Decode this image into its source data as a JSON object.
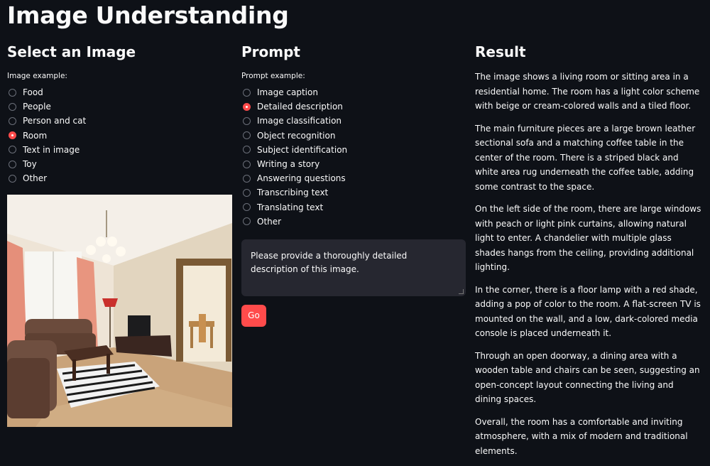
{
  "page_title": "Image Understanding",
  "left": {
    "heading": "Select an Image",
    "group_label": "Image example:",
    "options": [
      "Food",
      "People",
      "Person and cat",
      "Room",
      "Text in image",
      "Toy",
      "Other"
    ],
    "selected": "Room"
  },
  "middle": {
    "heading": "Prompt",
    "group_label": "Prompt example:",
    "options": [
      "Image caption",
      "Detailed description",
      "Image classification",
      "Object recognition",
      "Subject identification",
      "Writing a story",
      "Answering questions",
      "Transcribing text",
      "Translating text",
      "Other"
    ],
    "selected": "Detailed description",
    "prompt_text": "Please provide a thoroughly detailed description of this image.",
    "go_label": "Go"
  },
  "right": {
    "heading": "Result",
    "paragraphs": [
      "The image shows a living room or sitting area in a residential home. The room has a light color scheme with beige or cream-colored walls and a tiled floor.",
      "The main furniture pieces are a large brown leather sectional sofa and a matching coffee table in the center of the room. There is a striped black and white area rug underneath the coffee table, adding some contrast to the space.",
      "On the left side of the room, there are large windows with peach or light pink curtains, allowing natural light to enter. A chandelier with multiple glass shades hangs from the ceiling, providing additional lighting.",
      "In the corner, there is a floor lamp with a red shade, adding a pop of color to the room. A flat-screen TV is mounted on the wall, and a low, dark-colored media console is placed underneath it.",
      "Through an open doorway, a dining area with a wooden table and chairs can be seen, suggesting an open-concept layout connecting the living and dining spaces.",
      "Overall, the room has a comfortable and inviting atmosphere, with a mix of modern and traditional elements."
    ]
  },
  "colors": {
    "background": "#0e1117",
    "accent": "#ff4b4b",
    "input_bg": "#262730",
    "text": "#fafafa"
  }
}
